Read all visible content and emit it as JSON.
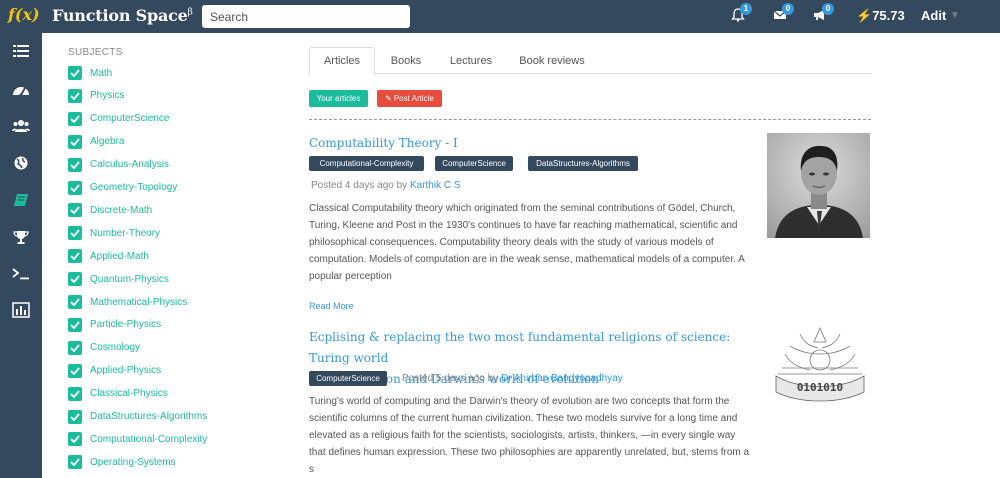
{
  "topbar": {
    "logo": "f(x)",
    "brand": "Function Space",
    "brand_sup": "β",
    "search_placeholder": "Search",
    "notifications_count": "1",
    "messages_count": "0",
    "announcements_count": "0",
    "points": "75.73",
    "username": "Adit"
  },
  "rail": {
    "items": [
      "list-icon",
      "dashboard-icon",
      "users-icon",
      "globe-icon",
      "book-icon",
      "trophy-icon",
      "terminal-icon",
      "chart-icon"
    ],
    "active": "book-icon"
  },
  "subjects": {
    "heading": "SUBJECTS",
    "items": [
      {
        "label": "Math",
        "checked": true
      },
      {
        "label": "Physics",
        "checked": true
      },
      {
        "label": "ComputerScience",
        "checked": true
      },
      {
        "label": "Algebra",
        "checked": true
      },
      {
        "label": "Calculus-Analysis",
        "checked": true
      },
      {
        "label": "Geometry-Topology",
        "checked": true
      },
      {
        "label": "Discrete-Math",
        "checked": true
      },
      {
        "label": "Number-Theory",
        "checked": true
      },
      {
        "label": "Applied-Math",
        "checked": true
      },
      {
        "label": "Quantum-Physics",
        "checked": true
      },
      {
        "label": "Mathematical-Physics",
        "checked": true
      },
      {
        "label": "Particle-Physics",
        "checked": true
      },
      {
        "label": "Cosmology",
        "checked": true
      },
      {
        "label": "Applied-Physics",
        "checked": true
      },
      {
        "label": "Classical-Physics",
        "checked": true
      },
      {
        "label": "DataStructures-Algorithms",
        "checked": true
      },
      {
        "label": "Computational-Complexity",
        "checked": true
      },
      {
        "label": "Operating-Systems",
        "checked": true
      }
    ]
  },
  "tabs": [
    {
      "label": "Articles",
      "active": true
    },
    {
      "label": "Books",
      "active": false
    },
    {
      "label": "Lectures",
      "active": false
    },
    {
      "label": "Book reviews",
      "active": false
    }
  ],
  "actions": {
    "your_articles": "Your articles",
    "post_article": "Post Article"
  },
  "colors": {
    "nav": "#34495e",
    "accent": "#1abc9c",
    "link": "#3498db",
    "danger": "#e74c3c"
  },
  "articles": [
    {
      "title": "Computability Theory - I",
      "tags": [
        "Computational-Complexity",
        "ComputerScience",
        "DataStructures-Algorithms"
      ],
      "posted": "Posted 4 days ago by",
      "author": "Karthik C S",
      "excerpt": "Classical Computability theory which originated from the seminal contributions of Gödel, Church, Turing, Kleene and Post in the 1930's continues to have far reaching mathematical, scientific and philosophical consequences. Computability theory deals with the study of various models of computation. Models of computation are in the weak sense, mathematical models of a computer. A popular perception",
      "read_more": "Read More"
    },
    {
      "title_line1": "Ecplising & replacing the two most fundamental religions of science: Turing world",
      "title_line2": "of computation and Darwin's world of evolution",
      "tags": [
        "ComputerScience"
      ],
      "posted": "Posted 5 days ago by",
      "author": "Dr Anirban Bandyopadhyay",
      "excerpt": "Turing's world of computing and the Darwin's theory of evolution are two concepts that form the scientific columns of the current human civilization. These two models survive for a long time and elevated as a religious faith for the scientists, sociologists, artists, thinkers, —in every single way that defines human expression. These two philosophies are apparently unrelated, but, stems from a s",
      "thumb_text": "0101010"
    }
  ]
}
